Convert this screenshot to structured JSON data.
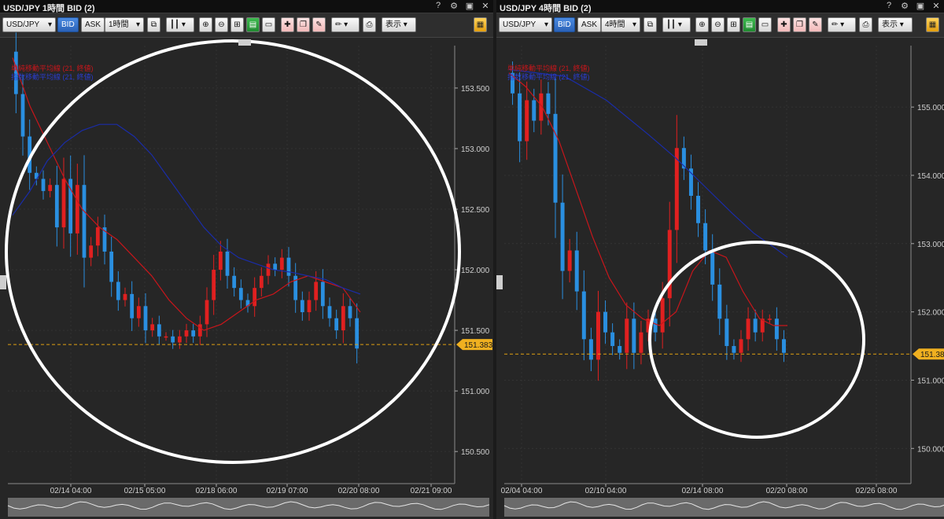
{
  "windows": [
    {
      "id": "left",
      "title": "USD/JPY 1時間 BID (2)",
      "toolbar": {
        "symbol": "USD/JPY",
        "bid": "BID",
        "ask": "ASK",
        "timeframe": "1時間",
        "view": "表示"
      },
      "legend": {
        "sma": "単純移動平均線 (21, 終値)",
        "ema": "指数移動平均線 (21, 終値)"
      },
      "current_price": "151.383",
      "chart_data": {
        "type": "candlestick",
        "y_ticks": [
          "153.500",
          "153.000",
          "152.500",
          "152.000",
          "151.500",
          "151.000",
          "150.500"
        ],
        "ylim": [
          150.3,
          153.85
        ],
        "x_ticks": [
          "02/14 04:00",
          "02/15 05:00",
          "02/18 06:00",
          "02/19 07:00",
          "02/20 08:00",
          "02/21 09:00"
        ],
        "price_path": [
          153.8,
          153.45,
          153.1,
          152.8,
          152.75,
          152.65,
          152.7,
          152.35,
          152.75,
          152.3,
          152.7,
          152.1,
          152.2,
          152.35,
          152.15,
          151.9,
          151.75,
          151.8,
          151.6,
          151.7,
          151.5,
          151.55,
          151.45,
          151.45,
          151.4,
          151.45,
          151.5,
          151.45,
          151.55,
          151.75,
          152.0,
          152.15,
          151.95,
          151.85,
          151.75,
          151.7,
          151.85,
          151.95,
          152.05,
          152.0,
          152.1,
          151.95,
          151.75,
          151.65,
          151.75,
          151.9,
          151.7,
          151.6,
          151.5,
          151.7,
          151.6,
          151.35
        ],
        "ma_lines": [
          {
            "name": "単純移動平均線 (21, 終値)",
            "color": "#c8161b",
            "points": [
              [
                0,
                153.75
              ],
              [
                0.05,
                153.35
              ],
              [
                0.1,
                153.05
              ],
              [
                0.15,
                152.75
              ],
              [
                0.2,
                152.5
              ],
              [
                0.25,
                152.35
              ],
              [
                0.3,
                152.25
              ],
              [
                0.35,
                152.1
              ],
              [
                0.4,
                151.95
              ],
              [
                0.45,
                151.75
              ],
              [
                0.5,
                151.6
              ],
              [
                0.55,
                151.5
              ],
              [
                0.6,
                151.55
              ],
              [
                0.65,
                151.65
              ],
              [
                0.7,
                151.75
              ],
              [
                0.75,
                151.8
              ],
              [
                0.8,
                151.9
              ],
              [
                0.85,
                151.95
              ],
              [
                0.9,
                151.9
              ],
              [
                0.95,
                151.85
              ],
              [
                1,
                151.65
              ]
            ]
          },
          {
            "name": "指数移動平均線 (21, 終値)",
            "color": "#1a2ca8",
            "points": [
              [
                0,
                152.45
              ],
              [
                0.05,
                152.65
              ],
              [
                0.1,
                152.9
              ],
              [
                0.15,
                153.05
              ],
              [
                0.2,
                153.15
              ],
              [
                0.25,
                153.2
              ],
              [
                0.3,
                153.2
              ],
              [
                0.35,
                153.1
              ],
              [
                0.4,
                152.95
              ],
              [
                0.45,
                152.75
              ],
              [
                0.5,
                152.55
              ],
              [
                0.55,
                152.35
              ],
              [
                0.6,
                152.2
              ],
              [
                0.65,
                152.1
              ],
              [
                0.7,
                152.05
              ],
              [
                0.75,
                152.0
              ],
              [
                0.8,
                151.98
              ],
              [
                0.85,
                151.95
              ],
              [
                0.9,
                151.92
              ],
              [
                0.95,
                151.85
              ],
              [
                1,
                151.8
              ]
            ]
          }
        ]
      }
    },
    {
      "id": "right",
      "title": "USD/JPY 4時間 BID (2)",
      "toolbar": {
        "symbol": "USD/JPY",
        "bid": "BID",
        "ask": "ASK",
        "timeframe": "4時間",
        "view": "表示"
      },
      "legend": {
        "sma": "単純移動平均線 (21, 終値)",
        "ema": "指数移動平均線 (21, 終値)"
      },
      "current_price": "151.383",
      "chart_data": {
        "type": "candlestick",
        "y_ticks": [
          "155.000",
          "154.000",
          "153.000",
          "152.000",
          "151.000",
          "150.000"
        ],
        "ylim": [
          149.6,
          155.9
        ],
        "x_ticks": [
          "02/04 04:00",
          "02/10 04:00",
          "02/14 08:00",
          "02/20 08:00",
          "02/26 08:00"
        ],
        "price_path": [
          155.5,
          155.2,
          154.5,
          155.1,
          154.8,
          155.2,
          154.9,
          153.6,
          152.6,
          152.9,
          152.3,
          151.6,
          151.3,
          152.0,
          151.7,
          151.5,
          151.4,
          151.9,
          151.4,
          151.7,
          151.9,
          151.7,
          152.2,
          153.2,
          154.4,
          154.1,
          153.7,
          153.3,
          152.9,
          152.4,
          151.9,
          151.5,
          151.4,
          151.6,
          151.9,
          151.7,
          151.9,
          151.9,
          151.6,
          151.4
        ],
        "ma_lines": [
          {
            "name": "単純移動平均線 (21, 終値)",
            "color": "#c8161b",
            "points": [
              [
                0,
                155.5
              ],
              [
                0.06,
                155.3
              ],
              [
                0.12,
                155.0
              ],
              [
                0.18,
                154.5
              ],
              [
                0.24,
                153.8
              ],
              [
                0.3,
                153.1
              ],
              [
                0.36,
                152.5
              ],
              [
                0.42,
                152.1
              ],
              [
                0.48,
                151.9
              ],
              [
                0.54,
                151.8
              ],
              [
                0.6,
                152.0
              ],
              [
                0.66,
                152.6
              ],
              [
                0.72,
                152.9
              ],
              [
                0.78,
                152.8
              ],
              [
                0.84,
                152.3
              ],
              [
                0.9,
                151.9
              ],
              [
                0.95,
                151.8
              ],
              [
                1,
                151.8
              ]
            ]
          },
          {
            "name": "指数移動平均線 (21, 終値)",
            "color": "#1a2ca8",
            "points": [
              [
                0,
                155.55
              ],
              [
                0.2,
                155.45
              ],
              [
                0.35,
                155.1
              ],
              [
                0.5,
                154.6
              ],
              [
                0.6,
                154.25
              ],
              [
                0.7,
                153.85
              ],
              [
                0.8,
                153.45
              ],
              [
                0.88,
                153.15
              ],
              [
                0.95,
                152.95
              ],
              [
                1,
                152.8
              ]
            ]
          }
        ]
      }
    }
  ]
}
